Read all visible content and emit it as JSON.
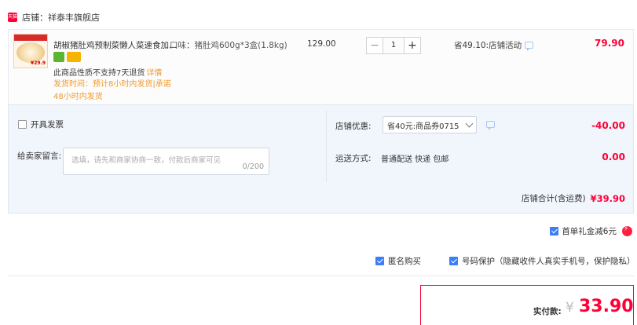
{
  "shop": {
    "badge": "天猫",
    "prefix": "店铺：",
    "name": "祥泰丰旗舰店"
  },
  "item": {
    "thumb_price": "¥29.9",
    "title": "胡椒猪肚鸡预制菜懒人菜速食加...",
    "sku": "口味：猪肚鸡600g*3盒(1.8kg)",
    "price": "129.00",
    "qty_minus": "−",
    "qty": "1",
    "qty_plus": "+",
    "promo": "省49.10:店铺活动",
    "subtotal": "79.90",
    "note_return": "此商品性质不支持7天退货",
    "note_return_link": "详情",
    "note_ship": "发货时间：预计8小时内发货|承诺48小时内发货"
  },
  "options": {
    "invoice_label": "开具发票",
    "message_label": "给卖家留言:",
    "message_placeholder": "选填，请先和商家协商一致，付款后商家可见",
    "message_count": "0/200",
    "coupon_label": "店铺优惠:",
    "coupon_value": "省40元:商品券0715",
    "coupon_amount": "-40.00",
    "shipping_label": "运送方式:",
    "shipping_value": "普通配送 快递 包邮",
    "shipping_amount": "0.00",
    "total_label": "店铺合计(含运费)",
    "total_amount": "¥39.90"
  },
  "extras": {
    "gift_label": "首单礼金减6元",
    "anonymous_label": "匿名购买",
    "privacy_label": "号码保护（隐藏收件人真实手机号，保护隐私）",
    "help_glyph": "?"
  },
  "payment": {
    "label": "实付款:",
    "currency": "¥",
    "amount": "33.90"
  },
  "colors": {
    "accent_red": "#ff0036",
    "link_orange": "#f09a2a",
    "check_blue": "#3d7ef7",
    "panel_bg": "#f1f6fd"
  }
}
